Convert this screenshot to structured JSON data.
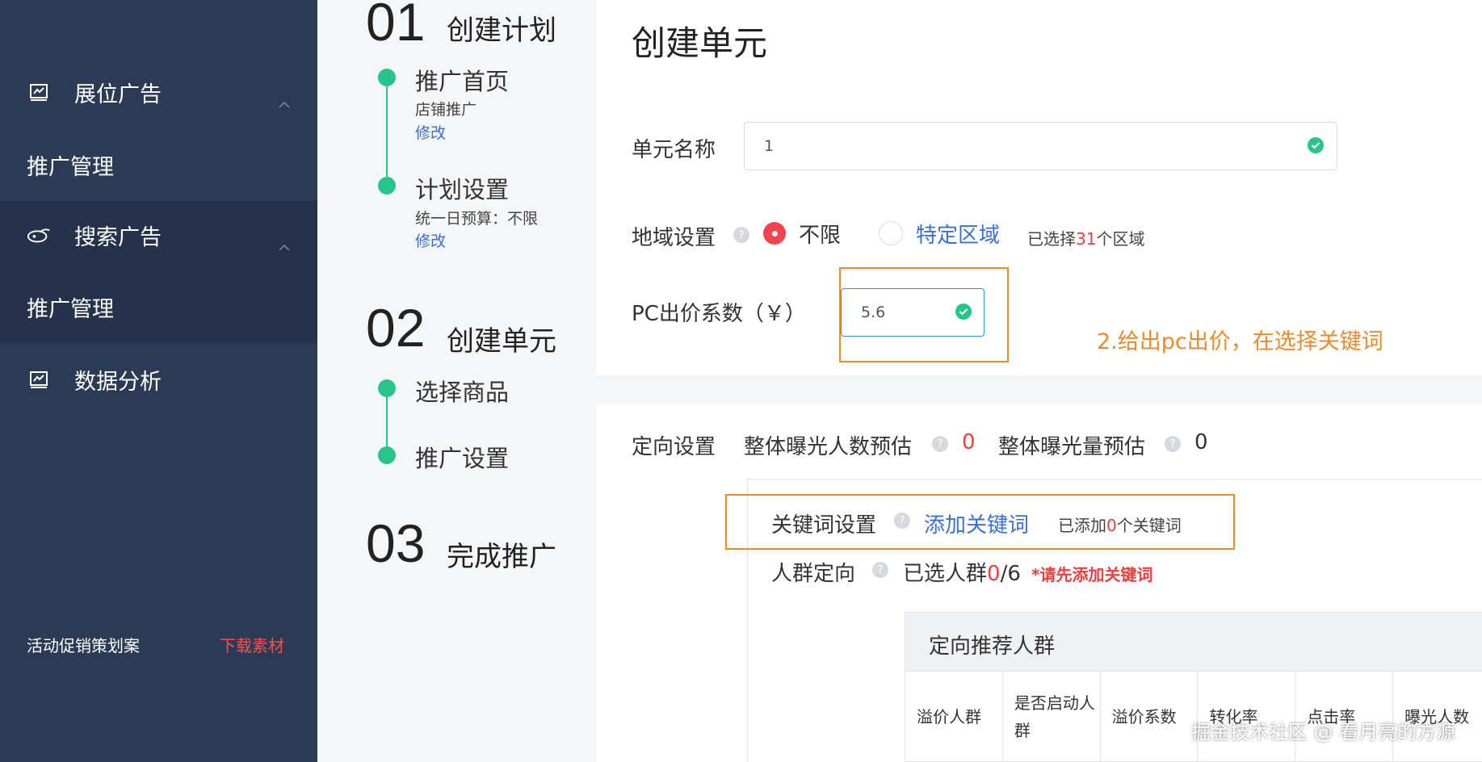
{
  "sidebar": {
    "groups": [
      {
        "label": "展位广告",
        "sub": "推广管理"
      },
      {
        "label": "搜索广告",
        "sub": "推广管理"
      },
      {
        "label": "数据分析"
      }
    ],
    "footer_text": "活动促销策划案",
    "footer_link": "下载素材"
  },
  "steps": {
    "s1": {
      "num": "01",
      "title": "创建计划",
      "items": [
        {
          "title": "推广首页",
          "desc": "店铺推广",
          "link": "修改"
        },
        {
          "title": "计划设置",
          "desc": "统一日预算：不限",
          "link": "修改"
        }
      ]
    },
    "s2": {
      "num": "02",
      "title": "创建单元",
      "items": [
        {
          "title": "选择商品"
        },
        {
          "title": "推广设置"
        }
      ]
    },
    "s3": {
      "num": "03",
      "title": "完成推广"
    }
  },
  "form": {
    "page_title": "创建单元",
    "unit_name_label": "单元名称",
    "unit_name_value": "1",
    "region_label": "地域设置",
    "region_opt_unlimited": "不限",
    "region_opt_specific": "特定区域",
    "region_selected_prefix": "已选择",
    "region_selected_count": "31",
    "region_selected_suffix": "个区域",
    "pc_bid_label": "PC出价系数（￥）",
    "pc_bid_value": "5.6",
    "annotation": "2.给出pc出价，在选择关键词"
  },
  "targeting": {
    "label": "定向设置",
    "exposure_people_label": "整体曝光人数预估",
    "exposure_people_value": "0",
    "exposure_volume_label": "整体曝光量预估",
    "exposure_volume_value": "0",
    "keyword_label": "关键词设置",
    "keyword_add": "添加关键词",
    "keyword_added_prefix": "已添加",
    "keyword_added_count": "0",
    "keyword_added_suffix": "个关键词",
    "crowd_label": "人群定向",
    "crowd_selected_prefix": "已选人群",
    "crowd_selected_count": "0",
    "crowd_selected_suffix": "/6",
    "crowd_warning": "*请先添加关键词",
    "table_title": "定向推荐人群",
    "columns": [
      "溢价人群",
      "是否启动人群",
      "溢价系数",
      "转化率",
      "点击率",
      "曝光人数"
    ]
  },
  "watermark": "掘金技术社区 @ 看月亮的方源",
  "colors": {
    "sidebar": "#2c3b55",
    "accent_green": "#27c58c",
    "link_blue": "#3a6fd8",
    "warn_red": "#ee4040",
    "annotation_orange": "#ef8a2c"
  }
}
